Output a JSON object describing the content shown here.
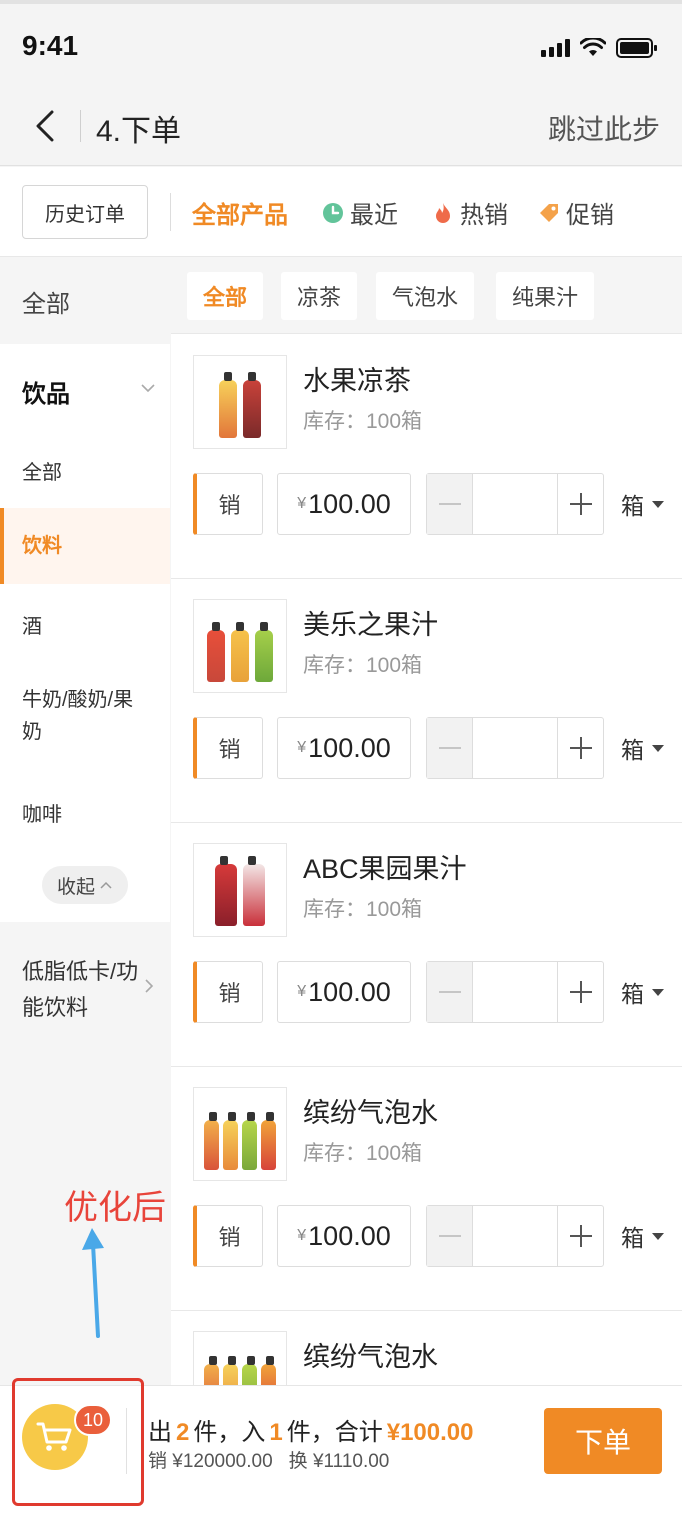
{
  "status_bar": {
    "time": "9:41"
  },
  "nav": {
    "title": "4.下单",
    "skip": "跳过此步"
  },
  "filter": {
    "history_button": "历史订单",
    "tabs": [
      {
        "label": "全部产品",
        "icon": ""
      },
      {
        "label": "最近",
        "icon": "clock-icon"
      },
      {
        "label": "热销",
        "icon": "flame-icon"
      },
      {
        "label": "促销",
        "icon": "tag-icon"
      }
    ],
    "active_tab": "全部产品"
  },
  "sidebar": {
    "all": "全部",
    "group": {
      "title": "饮品",
      "items": [
        "全部",
        "饮料",
        "酒",
        "牛奶/酸奶/果奶",
        "咖啡"
      ],
      "active": "饮料",
      "collapse": "收起"
    },
    "next_group": "低脂低卡/功能饮料"
  },
  "subcategories": {
    "chips": [
      "全部",
      "凉茶",
      "气泡水",
      "纯果汁"
    ],
    "active": "全部"
  },
  "products": [
    {
      "name": "水果凉茶",
      "stock": "库存：100箱",
      "sell": "销",
      "currency": "¥",
      "price": "100.00",
      "unit": "箱"
    },
    {
      "name": "美乐之果汁",
      "stock": "库存：100箱",
      "sell": "销",
      "currency": "¥",
      "price": "100.00",
      "unit": "箱"
    },
    {
      "name": "ABC果园果汁",
      "stock": "库存：100箱",
      "sell": "销",
      "currency": "¥",
      "price": "100.00",
      "unit": "箱"
    },
    {
      "name": "缤纷气泡水",
      "stock": "库存：100箱",
      "sell": "销",
      "currency": "¥",
      "price": "100.00",
      "unit": "箱"
    },
    {
      "name": "缤纷气泡水"
    }
  ],
  "annotation": {
    "text": "优化后"
  },
  "bottom": {
    "cart_count": "10",
    "out_label": "出",
    "out_count": "2",
    "in_label": "件，入",
    "in_count": "1",
    "total_label": "件，合计",
    "total_value": "¥100.00",
    "sell_summary": "销 ¥120000.00",
    "exchange_summary": "换 ¥1110.00",
    "order_button": "下单"
  },
  "colors": {
    "accent": "#f08a25",
    "cart": "#f7c948",
    "badge": "#ea5f3b",
    "highlight_box": "#e03a2e",
    "annotation": "#e8443a",
    "arrow": "#4aa8e8"
  }
}
